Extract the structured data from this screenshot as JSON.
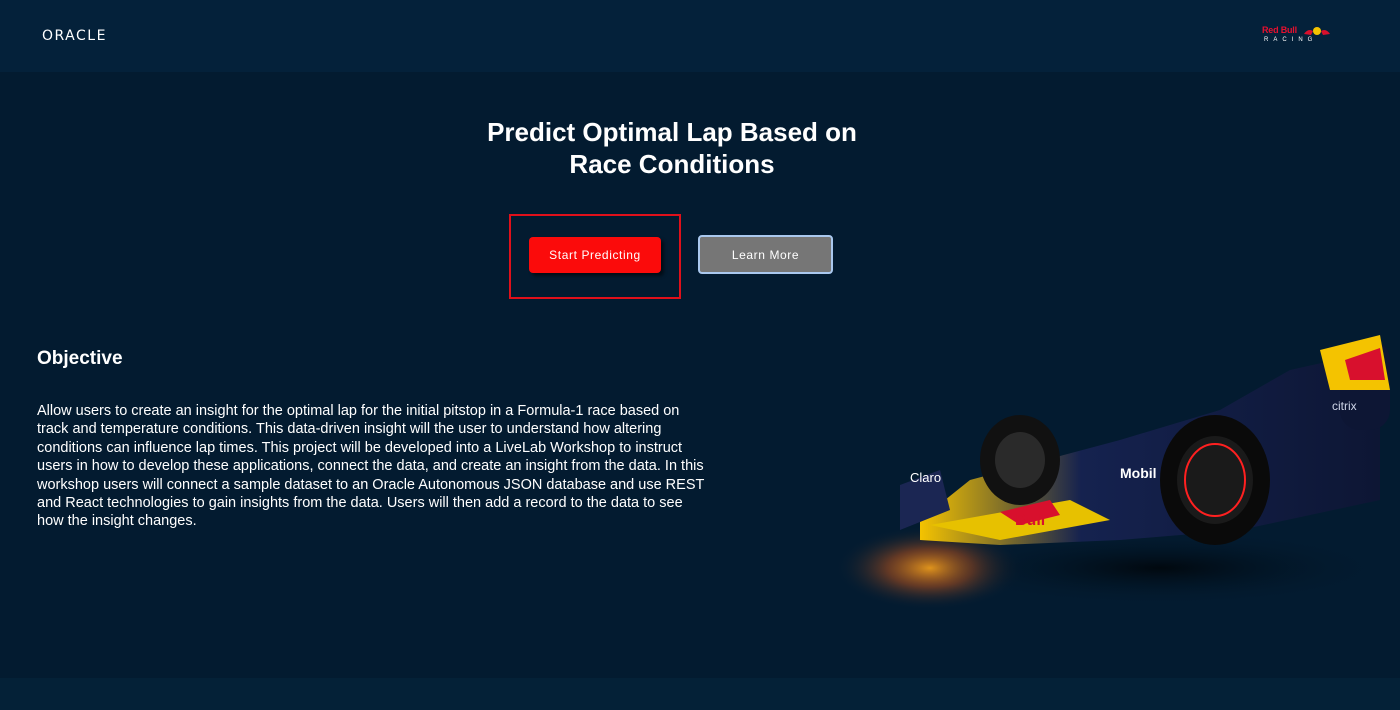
{
  "header": {
    "oracle_logo": "ORACLE",
    "partner_logo": {
      "word": "Red Bull",
      "sub": "RACING"
    }
  },
  "hero": {
    "title": "Predict Optimal Lap Based on Race Conditions",
    "start_button_label": "Start Predicting",
    "learn_more_label": "Learn More"
  },
  "objective": {
    "heading": "Objective",
    "body": "Allow users to create an insight for the optimal lap for the initial pitstop in a Formula-1 race based on track and temperature conditions. This data-driven insight will the user to understand how altering conditions can influence lap times. This project will be developed into a LiveLab Workshop to instruct users in how to develop these applications, connect the data, and create an insight from the data. In this workshop users will connect a sample dataset to an Oracle Autonomous JSON database and use REST and React technologies to gain insights from the data. Users will then add a record to the data to see how the insight changes."
  },
  "car_image": {
    "sponsor_labels": [
      "Claro",
      "Mobil",
      "citrix",
      "Bull"
    ]
  },
  "colors": {
    "background": "#031b30",
    "header": "#04213a",
    "start_button": "#fb0b0b",
    "learn_button": "#767676",
    "highlight": "#e0101a"
  }
}
